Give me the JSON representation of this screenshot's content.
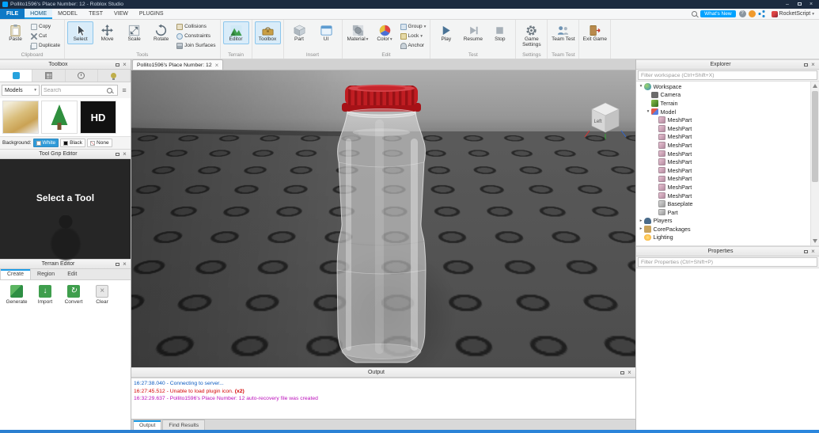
{
  "window": {
    "title": "Pollito1596's Place Number: 12 - Roblox Studio"
  },
  "colors": {
    "accent_blue": "#00a2ff",
    "title_bar": "#1c2b40",
    "selected_tool_highlight": "#d9ecf9",
    "output_info": "#0c5bc0",
    "output_error": "#d40707",
    "output_notice": "#bb0fbb",
    "bottle_cap_red": "#c01d22"
  },
  "icons": {
    "close": "×",
    "minimize": "–",
    "dropdown": "▾",
    "collapse": "▾",
    "expand": "▸",
    "help": "?",
    "import_arrow": "↓",
    "convert_arrow": "↻",
    "clear_x": "×",
    "sort": "≡"
  },
  "menu_bar": {
    "items": [
      "FILE",
      "HOME",
      "MODEL",
      "TEST",
      "VIEW",
      "PLUGINS"
    ],
    "active_item": "HOME",
    "whats_new_label": "What's New",
    "plugin_label": "RocketScript"
  },
  "ribbon": {
    "clipboard": {
      "section_label": "Clipboard",
      "paste": "Paste",
      "copy": "Copy",
      "cut": "Cut",
      "duplicate": "Duplicate"
    },
    "tools": {
      "section_label": "Tools",
      "select": "Select",
      "move": "Move",
      "scale": "Scale",
      "rotate": "Rotate",
      "collisions": "Collisions",
      "constraints": "Constraints",
      "join_surfaces": "Join Surfaces"
    },
    "terrain": {
      "section_label": "Terrain",
      "editor": "Editor"
    },
    "toolbox_label": "Toolbox",
    "insert": {
      "section_label": "Insert",
      "part": "Part",
      "ui": "UI"
    },
    "edit": {
      "section_label": "Edit",
      "material": "Material",
      "color": "Color",
      "group": "Group",
      "lock": "Lock",
      "anchor": "Anchor"
    },
    "test": {
      "section_label": "Test",
      "play": "Play",
      "resume": "Resume",
      "stop": "Stop"
    },
    "settings": {
      "section_label": "Settings",
      "game_settings": "Game Settings"
    },
    "team_test": {
      "section_label": "Team Test",
      "button": "Team Test"
    },
    "exit": {
      "button": "Exit Game"
    }
  },
  "toolbox_panel": {
    "header": "Toolbox",
    "category_selected": "Models",
    "search_placeholder": "Search",
    "hd_tile_label": "HD",
    "background_label": "Background:",
    "background_options": [
      "White",
      "Black",
      "None"
    ],
    "background_selected": "White"
  },
  "tool_grip_panel": {
    "header": "Tool Grip Editor",
    "message": "Select a Tool"
  },
  "terrain_editor_panel": {
    "header": "Terrain Editor",
    "tabs": [
      "Create",
      "Region",
      "Edit"
    ],
    "active_tab": "Create",
    "buttons": [
      "Generate",
      "Import",
      "Convert",
      "Clear"
    ]
  },
  "viewport": {
    "tab_title": "Pollito1596's Place Number: 12",
    "view_cube_face": "Left"
  },
  "explorer": {
    "header": "Explorer",
    "filter_placeholder": "Filter workspace (Ctrl+Shift+X)",
    "tree": [
      {
        "label": "Workspace"
      },
      {
        "label": "Camera"
      },
      {
        "label": "Terrain"
      },
      {
        "label": "Model"
      },
      {
        "label": "MeshPart"
      },
      {
        "label": "MeshPart"
      },
      {
        "label": "MeshPart"
      },
      {
        "label": "MeshPart"
      },
      {
        "label": "MeshPart"
      },
      {
        "label": "MeshPart"
      },
      {
        "label": "MeshPart"
      },
      {
        "label": "MeshPart"
      },
      {
        "label": "MeshPart"
      },
      {
        "label": "MeshPart"
      },
      {
        "label": "Baseplate"
      },
      {
        "label": "Part"
      },
      {
        "label": "Players"
      },
      {
        "label": "CorePackages"
      },
      {
        "label": "Lighting"
      }
    ]
  },
  "properties_panel": {
    "header": "Properties",
    "filter_placeholder": "Filter Properties (Ctrl+Shift+P)"
  },
  "output_panel": {
    "header": "Output",
    "lines": [
      {
        "text": "16:27:38.040 - Connecting to server...",
        "type": "info"
      },
      {
        "text": "16:27:45.512 - Unable to load plugin icon.",
        "count": "(x2)",
        "type": "error"
      },
      {
        "text": "16:32:29.637 - Pollito1596's Place Number: 12 auto-recovery file was created",
        "type": "notice"
      }
    ],
    "tabs": [
      "Output",
      "Find Results"
    ],
    "active_tab": "Output"
  }
}
